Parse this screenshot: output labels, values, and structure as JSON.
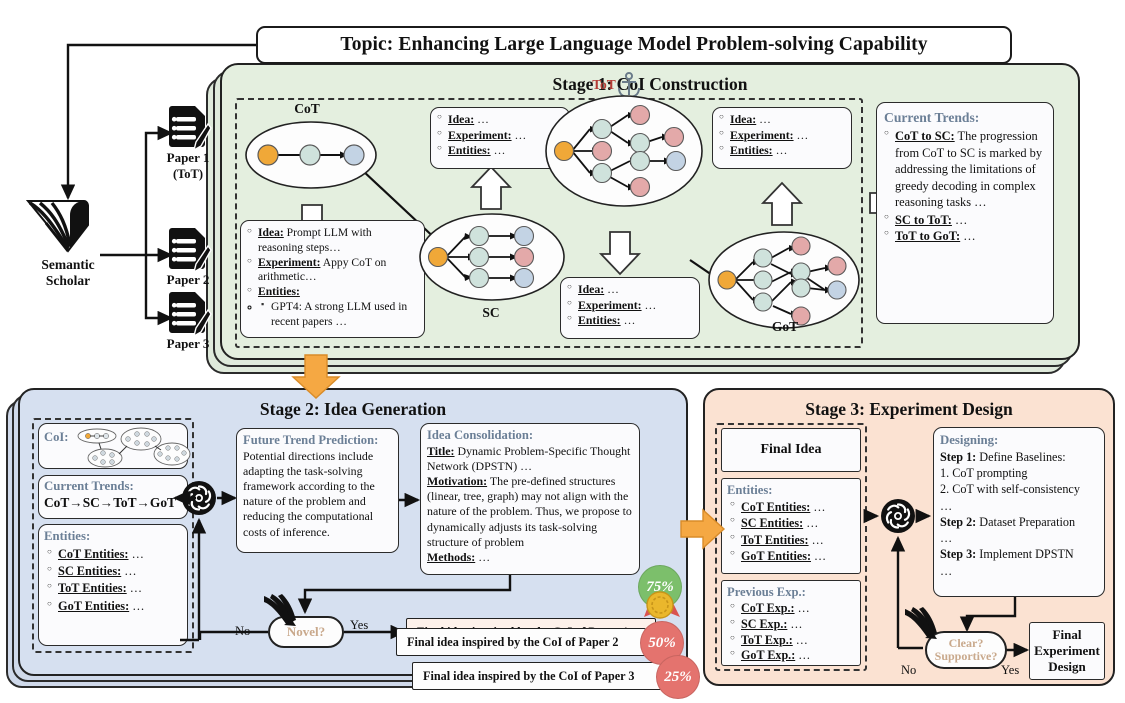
{
  "topic": {
    "label": "Topic: Enhancing Large Language Model Problem-solving Capability"
  },
  "source": {
    "name": "Semantic Scholar",
    "icon": "book-icon",
    "papers": [
      {
        "title": "Paper 1",
        "subtitle": "(ToT)",
        "icon": "document-edit-icon"
      },
      {
        "title": "Paper 2",
        "subtitle": "",
        "icon": "document-edit-icon"
      },
      {
        "title": "Paper 3",
        "subtitle": "",
        "icon": "document-edit-icon"
      }
    ]
  },
  "stage1": {
    "title": "Stage 1: CoI Construction",
    "methods": [
      {
        "name": "CoT",
        "anchor": false
      },
      {
        "name": "SC",
        "anchor": false
      },
      {
        "name": "ToT",
        "anchor": true,
        "anchor_icon": "anchor-icon"
      },
      {
        "name": "GoT",
        "anchor": false
      }
    ],
    "cot_card": {
      "idea_label": "Idea:",
      "idea_text": "Prompt LLM with reasoning steps…",
      "experiment_label": "Experiment:",
      "experiment_text": "Appy CoT on arithmetic…",
      "entities_label": "Entities:",
      "entity_item": "GPT4: A strong LLM used in recent papers …"
    },
    "stub_card": {
      "idea_label": "Idea:",
      "idea_text": "…",
      "experiment_label": "Experiment:",
      "experiment_text": "…",
      "entities_label": "Entities:",
      "entities_text": "…"
    },
    "trends": {
      "header": "Current Trends:",
      "items": [
        {
          "label": "CoT to SC:",
          "text": "The progression from CoT to SC is marked by addressing the limitations of greedy decoding in complex reasoning tasks …"
        },
        {
          "label": "SC to ToT:",
          "text": "…"
        },
        {
          "label": "ToT to GoT:",
          "text": "…"
        }
      ]
    }
  },
  "stage2": {
    "title": "Stage 2: Idea Generation",
    "coi": {
      "label": "CoI:"
    },
    "trends": {
      "header": "Current Trends:",
      "chain": "CoT→SC→ToT→GoT"
    },
    "entities": {
      "header": "Entities:",
      "items": [
        {
          "label": "CoT Entities:",
          "text": "…"
        },
        {
          "label": "SC Entities:",
          "text": "…"
        },
        {
          "label": "ToT Entities:",
          "text": "…"
        },
        {
          "label": "GoT Entities:",
          "text": "…"
        }
      ]
    },
    "llm_icon": "openai-logo-icon",
    "future_trend": {
      "header": "Future Trend Prediction:",
      "text": "Potential directions include adapting the task-solving framework according to the nature of the problem and reducing the computational costs of inference."
    },
    "consolidation": {
      "header": "Idea Consolidation:",
      "title_label": "Title:",
      "title_text": "Dynamic Problem-Specific Thought Network (DPSTN) …",
      "motivation_label": "Motivation:",
      "motivation_text": "The pre-defined structures (linear, tree, graph) may not align with the nature of the problem. Thus, we propose to dynamically adjusts its task-solving structure of problem",
      "methods_label": "Methods:",
      "methods_text": "…"
    },
    "decision": {
      "label": "Novel?",
      "no": "No",
      "yes": "Yes"
    },
    "final_ideas": [
      {
        "text": "Final idea inspired by the CoI of Paper 1",
        "score": "75%",
        "color": "#7cbf6b",
        "medal": true
      },
      {
        "text": "Final idea inspired by the CoI of Paper 2",
        "score": "50%",
        "color": "#e4736e",
        "medal": false
      },
      {
        "text": "Final idea inspired by the CoI of Paper 3",
        "score": "25%",
        "color": "#e4736e",
        "medal": false
      }
    ]
  },
  "stage3": {
    "title": "Stage 3: Experiment Design",
    "final_idea": "Final Idea",
    "entities": {
      "header": "Entities:",
      "items": [
        {
          "label": "CoT Entities:",
          "text": "…"
        },
        {
          "label": "SC Entities:",
          "text": "…"
        },
        {
          "label": "ToT Entities:",
          "text": "…"
        },
        {
          "label": "GoT Entities:",
          "text": "…"
        }
      ]
    },
    "previous_exp": {
      "header": "Previous Exp.:",
      "items": [
        {
          "label": "CoT Exp.:",
          "text": "…"
        },
        {
          "label": "SC Exp.:",
          "text": "…"
        },
        {
          "label": "ToT Exp.:",
          "text": "…"
        },
        {
          "label": "GoT Exp.:",
          "text": "…"
        }
      ]
    },
    "llm_icon": "openai-logo-icon",
    "designing": {
      "header": "Designing:",
      "step1_label": "Step 1:",
      "step1_text": "Define Baselines:",
      "step1_items": [
        "1. CoT prompting",
        "2. CoT with self-consistency",
        "…"
      ],
      "step2_label": "Step 2:",
      "step2_text": "Dataset Preparation",
      "step2_more": "…",
      "step3_label": "Step 3:",
      "step3_text": "Implement DPSTN",
      "step3_more": "…"
    },
    "decision": {
      "line1": "Clear?",
      "line2": "Supportive?",
      "no": "No",
      "yes": "Yes"
    },
    "output": "Final Experiment Design"
  },
  "colors": {
    "stage1_bg": "#e4efdf",
    "stage2_bg": "#d6e0f0",
    "stage3_bg": "#fbe2d2",
    "node_orange": "#f0a838",
    "node_green": "#cfe2dc",
    "node_blue": "#c3d3e4",
    "node_red": "#e3a9a9",
    "arrow_orange": "#f5a843",
    "header_blue": "#6b7f96",
    "tot_red": "#b43d36"
  }
}
